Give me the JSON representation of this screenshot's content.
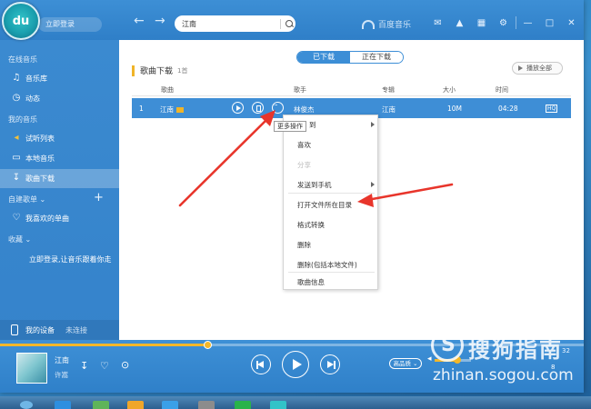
{
  "header": {
    "login_label": "立即登录",
    "search_value": "江南",
    "brand_label": "百度音乐"
  },
  "sidebar": {
    "section_online": "在线音乐",
    "item_library": "音乐库",
    "item_feed": "动态",
    "section_mine": "我的音乐",
    "item_trial": "试听列表",
    "item_local": "本地音乐",
    "item_download": "歌曲下载",
    "section_playlists": "自建歌单",
    "item_favorites": "我喜欢的单曲",
    "section_collect": "收藏",
    "collect_hint": "立即登录,让音乐跟着你走",
    "device_label": "我的设备",
    "device_status": "未连接"
  },
  "tabs": {
    "downloaded": "已下载",
    "downloading": "正在下载"
  },
  "downloads": {
    "title": "歌曲下载",
    "count": "1首",
    "play_all": "播放全部"
  },
  "table": {
    "columns": {
      "song": "歌曲",
      "artist": "歌手",
      "album": "专辑",
      "size": "大小",
      "time": "时间"
    },
    "rows": [
      {
        "index": "1",
        "song": "江南",
        "artist": "林俊杰",
        "album": "江南",
        "size": "10M",
        "time": "04:28",
        "quality": "HQ"
      }
    ]
  },
  "tooltip": "更多操作",
  "context_menu": {
    "add_to": "到",
    "like": "喜欢",
    "share": "分享",
    "send_phone": "发送到手机",
    "open_folder": "打开文件所在目录",
    "convert": "格式转换",
    "delete": "删除",
    "delete_with_file": "删除(包括本地文件)",
    "song_info": "歌曲信息"
  },
  "player": {
    "song": "江南",
    "artist": "许嵩",
    "quality": "高品质",
    "time_label": "32",
    "count": "8",
    "progress": 0.355,
    "volume": 0.6
  },
  "watermark": {
    "brand": "搜狗指南",
    "url": "zhinan.sogou.com"
  }
}
